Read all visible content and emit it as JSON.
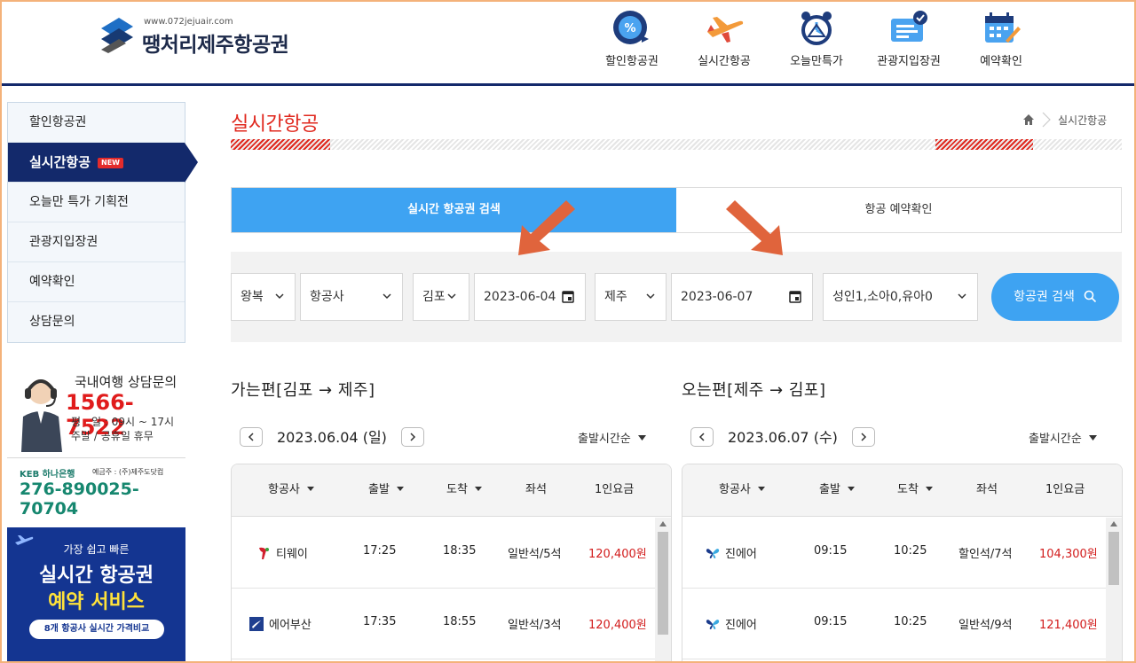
{
  "logo": {
    "url": "www.072jejuair.com",
    "name": "땡처리제주항공권"
  },
  "top_nav": [
    {
      "label": "할인항공권",
      "icon": "percent-clock-icon"
    },
    {
      "label": "실시간항공",
      "icon": "airplane-icon"
    },
    {
      "label": "오늘만특가",
      "icon": "alarm-clock-icon"
    },
    {
      "label": "관광지입장권",
      "icon": "ticket-check-icon"
    },
    {
      "label": "예약확인",
      "icon": "calendar-check-icon"
    }
  ],
  "sidebar": {
    "items": [
      {
        "label": "할인항공권"
      },
      {
        "label": "실시간항공",
        "badge": "NEW"
      },
      {
        "label": "오늘만 특가 기획전"
      },
      {
        "label": "관광지입장권"
      },
      {
        "label": "예약확인"
      },
      {
        "label": "상담문의"
      }
    ],
    "support": {
      "title": "국내여행 상담문의",
      "phone": "1566-7522",
      "hours_weekday": "평　일 : 09시 ~ 17시",
      "hours_weekend": "주말 / 공휴일 휴무"
    },
    "bank": {
      "name": "KEB 하나은행",
      "holder": "예금주 : (주)제주도닷컴",
      "account": "276-890025-70704"
    },
    "promo": {
      "sub": "가장 쉽고 빠른",
      "line1": "실시간 항공권",
      "line2": "예약 서비스",
      "bar": "8개 항공사 실시간 가격비교"
    }
  },
  "page": {
    "title": "실시간항공",
    "breadcrumb": "실시간항공"
  },
  "tabs": [
    {
      "label": "실시간 항공권 검색",
      "active": true
    },
    {
      "label": "항공 예약확인",
      "active": false
    }
  ],
  "search": {
    "trip_type": "왕복",
    "airline": "항공사",
    "departure": "김포",
    "departure_date": "2023-06-04",
    "arrival": "제주",
    "return_date": "2023-06-07",
    "passengers": "성인1,소아0,유아0",
    "button": "항공권 검색"
  },
  "outbound": {
    "title": "가는편[김포 → 제주]",
    "date": "2023.06.04 (일)",
    "sort": "출발시간순",
    "headers": {
      "airline": "항공사",
      "depart": "출발",
      "arrive": "도착",
      "seat": "좌석",
      "price": "1인요금"
    },
    "rows": [
      {
        "airline": "티웨이",
        "depart": "17:25",
        "arrive": "18:35",
        "seat": "일반석/5석",
        "price": "120,400원"
      },
      {
        "airline": "에어부산",
        "depart": "17:35",
        "arrive": "18:55",
        "seat": "일반석/3석",
        "price": "120,400원"
      }
    ]
  },
  "inbound": {
    "title": "오는편[제주 → 김포]",
    "date": "2023.06.07 (수)",
    "sort": "출발시간순",
    "headers": {
      "airline": "항공사",
      "depart": "출발",
      "arrive": "도착",
      "seat": "좌석",
      "price": "1인요금"
    },
    "rows": [
      {
        "airline": "진에어",
        "depart": "09:15",
        "arrive": "10:25",
        "seat": "할인석/7석",
        "price": "104,300원"
      },
      {
        "airline": "진에어",
        "depart": "09:15",
        "arrive": "10:25",
        "seat": "일반석/9석",
        "price": "121,400원"
      }
    ]
  },
  "colors": {
    "accent_blue": "#3ea3f2",
    "navy": "#13296b",
    "title_red": "#e0281e",
    "price_red": "#d21c1c",
    "annotation_arrow": "#e0643c"
  }
}
